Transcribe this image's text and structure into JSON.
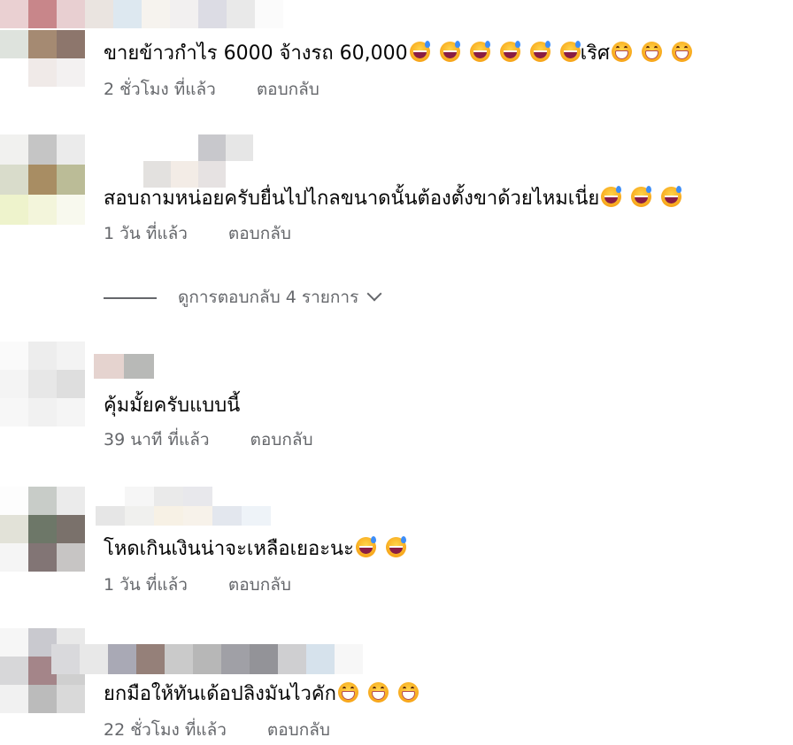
{
  "comments": [
    {
      "text": "ขายข้าวกำไร 6000 จ้างรถ 60,000",
      "emojis": [
        "sweat",
        "sweat",
        "sweat",
        "sweat",
        "sweat",
        "sweat"
      ],
      "suffix": "เริศ",
      "suffix_emojis": [
        "grin",
        "grin",
        "grin"
      ],
      "time": "2 ชั่วโมง ที่แล้ว",
      "reply": "ตอบกลับ"
    },
    {
      "text": "สอบถามหน่อยครับยื่นไปไกลขนาดนั้นต้องตั้งขาด้วยไหมเนี่ย",
      "emojis": [
        "sweat",
        "sweat",
        "sweat"
      ],
      "time": "1 วัน ที่แล้ว",
      "reply": "ตอบกลับ"
    },
    {
      "text": "คุ้มมั้ยครับแบบนี้",
      "emojis": [],
      "time": "39 นาที ที่แล้ว",
      "reply": "ตอบกลับ"
    },
    {
      "text": "โหดเกินเงินน่าจะเหลือเยอะนะ",
      "emojis": [
        "sweat",
        "sweat"
      ],
      "time": "1 วัน ที่แล้ว",
      "reply": "ตอบกลับ"
    },
    {
      "text": "ยกมือให้ทันเด้อปลิงมันไวคัก",
      "emojis": [
        "grin",
        "grin",
        "grin"
      ],
      "time": "22 ชั่วโมง ที่แล้ว",
      "reply": "ตอบกลับ"
    }
  ],
  "view_replies": "ดูการตอบกลับ 4 รายการ",
  "icons": {
    "expand": "chevron-down-icon",
    "sweat": "grinning-sweat-emoji",
    "grin": "grimacing-emoji"
  },
  "colors": {
    "text": "#050505",
    "meta": "#65676b",
    "background": "#ffffff"
  }
}
